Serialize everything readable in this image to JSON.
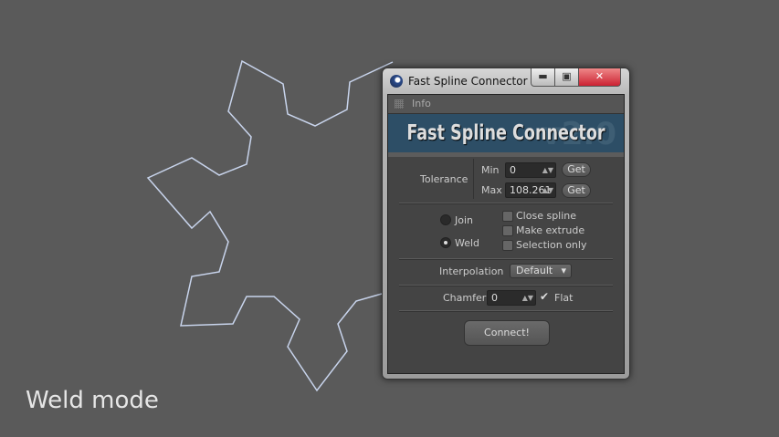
{
  "caption": "Weld mode",
  "window": {
    "title": "Fast Spline Connector ...",
    "min_icon": "minimize-icon",
    "max_icon": "maximize-icon",
    "close_icon": "close-icon"
  },
  "info": {
    "label": "Info"
  },
  "banner": {
    "title": "Fast Spline Connector",
    "version": "v2.0"
  },
  "tolerance": {
    "label": "Tolerance",
    "min_label": "Min",
    "min_value": "0",
    "max_label": "Max",
    "max_value": "108.261",
    "get_label": "Get"
  },
  "mode": {
    "join": "Join",
    "weld": "Weld",
    "selected": "Weld"
  },
  "options": [
    {
      "label": "Close spline",
      "checked": false
    },
    {
      "label": "Make extrude",
      "checked": false
    },
    {
      "label": "Selection only",
      "checked": false
    }
  ],
  "interpolation": {
    "label": "Interpolation",
    "value": "Default"
  },
  "chamfer": {
    "label": "Chamfer",
    "value": "0",
    "flat_label": "Flat",
    "flat_checked": true
  },
  "connect": "Connect!"
}
